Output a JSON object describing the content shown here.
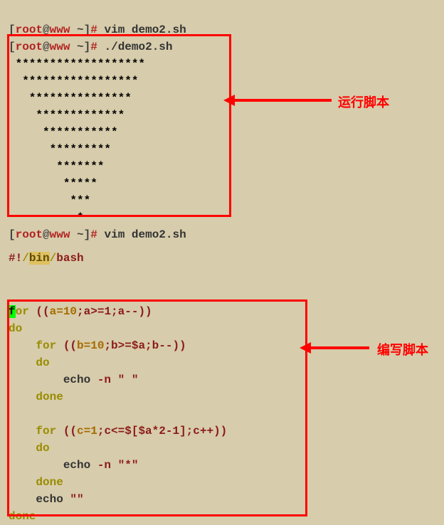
{
  "prompts": {
    "line1_cmd": "vim demo2.sh",
    "line2_cmd": "./demo2.sh",
    "line3_cmd": "vim demo2.sh",
    "user": "root",
    "host": "www",
    "path": "~"
  },
  "output": {
    "rows": [
      " *******************",
      "  *****************",
      "   ***************",
      "    *************",
      "     ***********",
      "      *********",
      "       *******",
      "        *****",
      "         ***",
      "          *"
    ]
  },
  "labels": {
    "run_script": "运行脚本",
    "write_script": "编写脚本"
  },
  "shebang": {
    "hash_bang": "#!",
    "slash1": "/",
    "bin": "bin",
    "slash2": "/",
    "bash": "bash"
  },
  "code": {
    "for_kw": "for",
    "do_kw": "do",
    "done_kw": "done",
    "echo": "echo",
    "loop1": "((",
    "loop1a": "a=10",
    "loop1b": ";a>=1;a--",
    "loop1c": "))",
    "loop2_pre": "    ",
    "loop2": "((",
    "loop2a": "b=10",
    "loop2b": ";b>=$a;b--",
    "loop2c": "))",
    "indent4": "    ",
    "indent8": "        ",
    "dash_n": "-n",
    "space_str": " \" \"",
    "star_str": " \"*\"",
    "empty_str": " \"\"",
    "loop3": "((",
    "loop3a": "c=1",
    "loop3b": ";c<=$[$a*2-1];c++",
    "loop3c": "))"
  }
}
